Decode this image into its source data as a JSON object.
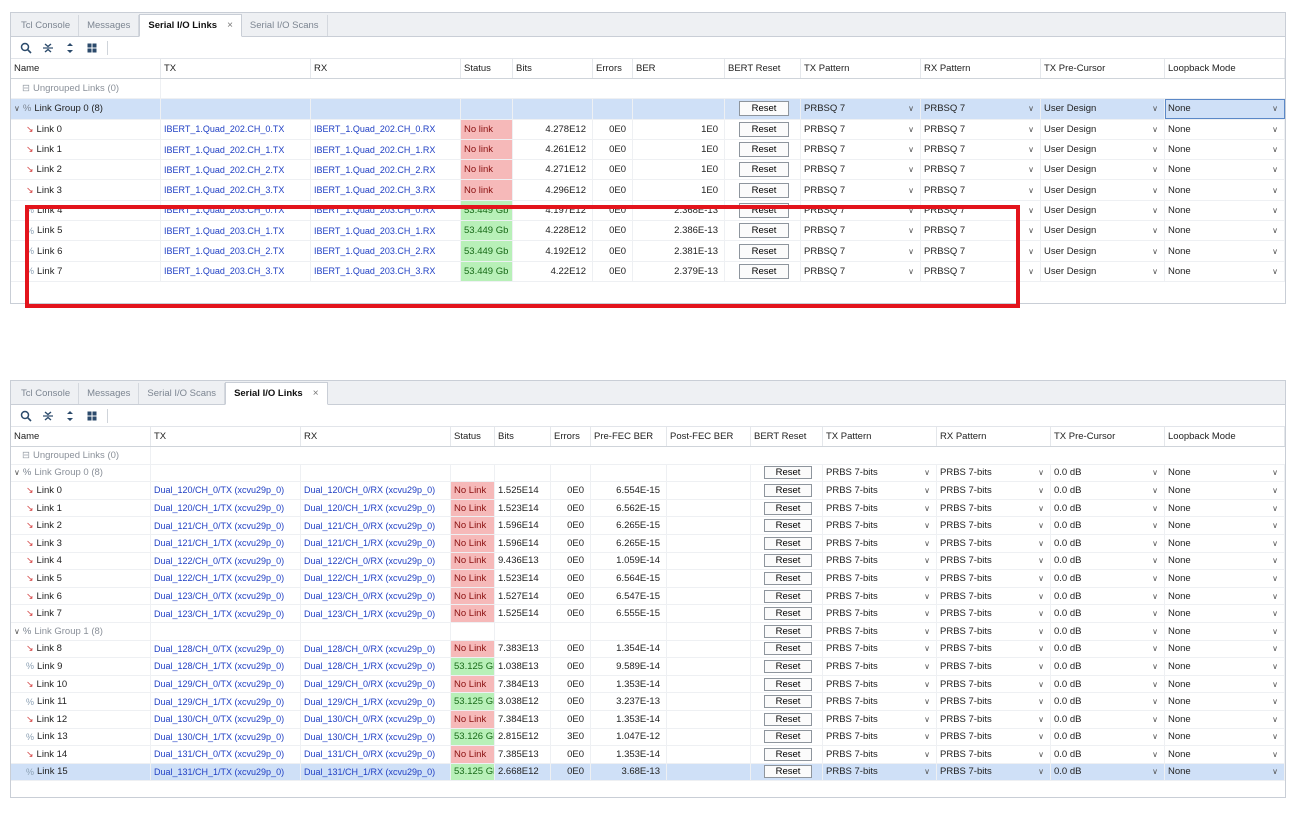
{
  "top": {
    "tabs": [
      {
        "label": "Tcl Console",
        "active": false
      },
      {
        "label": "Messages",
        "active": false
      },
      {
        "label": "Serial I/O Links",
        "active": true,
        "closable": true
      },
      {
        "label": "Serial I/O Scans",
        "active": false
      }
    ],
    "columns": [
      "Name",
      "TX",
      "RX",
      "Status",
      "Bits",
      "Errors",
      "BER",
      "BERT Reset",
      "TX Pattern",
      "RX Pattern",
      "TX Pre-Cursor",
      "Loopback Mode"
    ],
    "ungrouped": {
      "name": "Ungrouped Links",
      "count": "(0)"
    },
    "group": {
      "name": "Link Group 0",
      "count": "(8)",
      "reset": "Reset",
      "tx_pattern": "PRBSQ 7",
      "rx_pattern": "PRBSQ 7",
      "precursor": "User Design",
      "loopback": "None"
    },
    "rows": [
      {
        "name": "Link 0",
        "tx": "IBERT_1.Quad_202.CH_0.TX",
        "rx": "IBERT_1.Quad_202.CH_0.RX",
        "status": "No link",
        "ok": false,
        "bits": "4.278E12",
        "errors": "0E0",
        "ber": "1E0",
        "reset": "Reset",
        "tx_pattern": "PRBSQ 7",
        "rx_pattern": "PRBSQ 7",
        "precursor": "User Design",
        "loopback": "None"
      },
      {
        "name": "Link 1",
        "tx": "IBERT_1.Quad_202.CH_1.TX",
        "rx": "IBERT_1.Quad_202.CH_1.RX",
        "status": "No link",
        "ok": false,
        "bits": "4.261E12",
        "errors": "0E0",
        "ber": "1E0",
        "reset": "Reset",
        "tx_pattern": "PRBSQ 7",
        "rx_pattern": "PRBSQ 7",
        "precursor": "User Design",
        "loopback": "None"
      },
      {
        "name": "Link 2",
        "tx": "IBERT_1.Quad_202.CH_2.TX",
        "rx": "IBERT_1.Quad_202.CH_2.RX",
        "status": "No link",
        "ok": false,
        "bits": "4.271E12",
        "errors": "0E0",
        "ber": "1E0",
        "reset": "Reset",
        "tx_pattern": "PRBSQ 7",
        "rx_pattern": "PRBSQ 7",
        "precursor": "User Design",
        "loopback": "None"
      },
      {
        "name": "Link 3",
        "tx": "IBERT_1.Quad_202.CH_3.TX",
        "rx": "IBERT_1.Quad_202.CH_3.RX",
        "status": "No link",
        "ok": false,
        "bits": "4.296E12",
        "errors": "0E0",
        "ber": "1E0",
        "reset": "Reset",
        "tx_pattern": "PRBSQ 7",
        "rx_pattern": "PRBSQ 7",
        "precursor": "User Design",
        "loopback": "None"
      },
      {
        "name": "Link 4",
        "tx": "IBERT_1.Quad_203.CH_0.TX",
        "rx": "IBERT_1.Quad_203.CH_0.RX",
        "status": "53.449 Gb",
        "ok": true,
        "bits": "4.197E12",
        "errors": "0E0",
        "ber": "2.368E-13",
        "reset": "Reset",
        "tx_pattern": "PRBSQ 7",
        "rx_pattern": "PRBSQ 7",
        "precursor": "User Design",
        "loopback": "None"
      },
      {
        "name": "Link 5",
        "tx": "IBERT_1.Quad_203.CH_1.TX",
        "rx": "IBERT_1.Quad_203.CH_1.RX",
        "status": "53.449 Gb",
        "ok": true,
        "bits": "4.228E12",
        "errors": "0E0",
        "ber": "2.386E-13",
        "reset": "Reset",
        "tx_pattern": "PRBSQ 7",
        "rx_pattern": "PRBSQ 7",
        "precursor": "User Design",
        "loopback": "None"
      },
      {
        "name": "Link 6",
        "tx": "IBERT_1.Quad_203.CH_2.TX",
        "rx": "IBERT_1.Quad_203.CH_2.RX",
        "status": "53.449 Gb",
        "ok": true,
        "bits": "4.192E12",
        "errors": "0E0",
        "ber": "2.381E-13",
        "reset": "Reset",
        "tx_pattern": "PRBSQ 7",
        "rx_pattern": "PRBSQ 7",
        "precursor": "User Design",
        "loopback": "None"
      },
      {
        "name": "Link 7",
        "tx": "IBERT_1.Quad_203.CH_3.TX",
        "rx": "IBERT_1.Quad_203.CH_3.RX",
        "status": "53.449 Gb",
        "ok": true,
        "bits": "4.22E12",
        "errors": "0E0",
        "ber": "2.379E-13",
        "reset": "Reset",
        "tx_pattern": "PRBSQ 7",
        "rx_pattern": "PRBSQ 7",
        "precursor": "User Design",
        "loopback": "None"
      }
    ]
  },
  "bottom": {
    "tabs": [
      {
        "label": "Tcl Console",
        "active": false
      },
      {
        "label": "Messages",
        "active": false
      },
      {
        "label": "Serial I/O Scans",
        "active": false
      },
      {
        "label": "Serial I/O Links",
        "active": true,
        "closable": true
      }
    ],
    "columns": [
      "Name",
      "TX",
      "RX",
      "Status",
      "Bits",
      "Errors",
      "Pre-FEC BER",
      "Post-FEC BER",
      "BERT Reset",
      "TX Pattern",
      "RX Pattern",
      "TX Pre-Cursor",
      "Loopback Mode"
    ],
    "ungrouped": {
      "name": "Ungrouped Links",
      "count": "(0)"
    },
    "rows": [
      {
        "kind": "group",
        "name": "Link Group 0",
        "count": "(8)",
        "reset": "Reset",
        "tx_pattern": "PRBS 7-bits",
        "rx_pattern": "PRBS 7-bits",
        "precursor": "0.0 dB",
        "loopback": "None"
      },
      {
        "kind": "link",
        "name": "Link 0",
        "tx": "Dual_120/CH_0/TX (xcvu29p_0)",
        "rx": "Dual_120/CH_0/RX (xcvu29p_0)",
        "status": "No Link",
        "ok": false,
        "bits": "1.525E14",
        "errors": "0E0",
        "pre": "6.554E-15",
        "post": "",
        "reset": "Reset",
        "tx_pattern": "PRBS 7-bits",
        "rx_pattern": "PRBS 7-bits",
        "precursor": "0.0 dB",
        "loopback": "None"
      },
      {
        "kind": "link",
        "name": "Link 1",
        "tx": "Dual_120/CH_1/TX (xcvu29p_0)",
        "rx": "Dual_120/CH_1/RX (xcvu29p_0)",
        "status": "No Link",
        "ok": false,
        "bits": "1.523E14",
        "errors": "0E0",
        "pre": "6.562E-15",
        "post": "",
        "reset": "Reset",
        "tx_pattern": "PRBS 7-bits",
        "rx_pattern": "PRBS 7-bits",
        "precursor": "0.0 dB",
        "loopback": "None"
      },
      {
        "kind": "link",
        "name": "Link 2",
        "tx": "Dual_121/CH_0/TX (xcvu29p_0)",
        "rx": "Dual_121/CH_0/RX (xcvu29p_0)",
        "status": "No Link",
        "ok": false,
        "bits": "1.596E14",
        "errors": "0E0",
        "pre": "6.265E-15",
        "post": "",
        "reset": "Reset",
        "tx_pattern": "PRBS 7-bits",
        "rx_pattern": "PRBS 7-bits",
        "precursor": "0.0 dB",
        "loopback": "None"
      },
      {
        "kind": "link",
        "name": "Link 3",
        "tx": "Dual_121/CH_1/TX (xcvu29p_0)",
        "rx": "Dual_121/CH_1/RX (xcvu29p_0)",
        "status": "No Link",
        "ok": false,
        "bits": "1.596E14",
        "errors": "0E0",
        "pre": "6.265E-15",
        "post": "",
        "reset": "Reset",
        "tx_pattern": "PRBS 7-bits",
        "rx_pattern": "PRBS 7-bits",
        "precursor": "0.0 dB",
        "loopback": "None"
      },
      {
        "kind": "link",
        "name": "Link 4",
        "tx": "Dual_122/CH_0/TX (xcvu29p_0)",
        "rx": "Dual_122/CH_0/RX (xcvu29p_0)",
        "status": "No Link",
        "ok": false,
        "bits": "9.436E13",
        "errors": "0E0",
        "pre": "1.059E-14",
        "post": "",
        "reset": "Reset",
        "tx_pattern": "PRBS 7-bits",
        "rx_pattern": "PRBS 7-bits",
        "precursor": "0.0 dB",
        "loopback": "None"
      },
      {
        "kind": "link",
        "name": "Link 5",
        "tx": "Dual_122/CH_1/TX (xcvu29p_0)",
        "rx": "Dual_122/CH_1/RX (xcvu29p_0)",
        "status": "No Link",
        "ok": false,
        "bits": "1.523E14",
        "errors": "0E0",
        "pre": "6.564E-15",
        "post": "",
        "reset": "Reset",
        "tx_pattern": "PRBS 7-bits",
        "rx_pattern": "PRBS 7-bits",
        "precursor": "0.0 dB",
        "loopback": "None"
      },
      {
        "kind": "link",
        "name": "Link 6",
        "tx": "Dual_123/CH_0/TX (xcvu29p_0)",
        "rx": "Dual_123/CH_0/RX (xcvu29p_0)",
        "status": "No Link",
        "ok": false,
        "bits": "1.527E14",
        "errors": "0E0",
        "pre": "6.547E-15",
        "post": "",
        "reset": "Reset",
        "tx_pattern": "PRBS 7-bits",
        "rx_pattern": "PRBS 7-bits",
        "precursor": "0.0 dB",
        "loopback": "None"
      },
      {
        "kind": "link",
        "name": "Link 7",
        "tx": "Dual_123/CH_1/TX (xcvu29p_0)",
        "rx": "Dual_123/CH_1/RX (xcvu29p_0)",
        "status": "No Link",
        "ok": false,
        "bits": "1.525E14",
        "errors": "0E0",
        "pre": "6.555E-15",
        "post": "",
        "reset": "Reset",
        "tx_pattern": "PRBS 7-bits",
        "rx_pattern": "PRBS 7-bits",
        "precursor": "0.0 dB",
        "loopback": "None"
      },
      {
        "kind": "group",
        "name": "Link Group 1",
        "count": "(8)",
        "reset": "Reset",
        "tx_pattern": "PRBS 7-bits",
        "rx_pattern": "PRBS 7-bits",
        "precursor": "0.0 dB",
        "loopback": "None"
      },
      {
        "kind": "link",
        "name": "Link 8",
        "tx": "Dual_128/CH_0/TX (xcvu29p_0)",
        "rx": "Dual_128/CH_0/RX (xcvu29p_0)",
        "status": "No Link",
        "ok": false,
        "bits": "7.383E13",
        "errors": "0E0",
        "pre": "1.354E-14",
        "post": "",
        "reset": "Reset",
        "tx_pattern": "PRBS 7-bits",
        "rx_pattern": "PRBS 7-bits",
        "precursor": "0.0 dB",
        "loopback": "None"
      },
      {
        "kind": "link",
        "name": "Link 9",
        "tx": "Dual_128/CH_1/TX (xcvu29p_0)",
        "rx": "Dual_128/CH_1/RX (xcvu29p_0)",
        "status": "53.125 Gb",
        "ok": true,
        "bits": "1.038E13",
        "errors": "0E0",
        "pre": "9.589E-14",
        "post": "",
        "reset": "Reset",
        "tx_pattern": "PRBS 7-bits",
        "rx_pattern": "PRBS 7-bits",
        "precursor": "0.0 dB",
        "loopback": "None"
      },
      {
        "kind": "link",
        "name": "Link 10",
        "tx": "Dual_129/CH_0/TX (xcvu29p_0)",
        "rx": "Dual_129/CH_0/RX (xcvu29p_0)",
        "status": "No Link",
        "ok": false,
        "bits": "7.384E13",
        "errors": "0E0",
        "pre": "1.353E-14",
        "post": "",
        "reset": "Reset",
        "tx_pattern": "PRBS 7-bits",
        "rx_pattern": "PRBS 7-bits",
        "precursor": "0.0 dB",
        "loopback": "None"
      },
      {
        "kind": "link",
        "name": "Link 11",
        "tx": "Dual_129/CH_1/TX (xcvu29p_0)",
        "rx": "Dual_129/CH_1/RX (xcvu29p_0)",
        "status": "53.125 Gb",
        "ok": true,
        "bits": "3.038E12",
        "errors": "0E0",
        "pre": "3.237E-13",
        "post": "",
        "reset": "Reset",
        "tx_pattern": "PRBS 7-bits",
        "rx_pattern": "PRBS 7-bits",
        "precursor": "0.0 dB",
        "loopback": "None"
      },
      {
        "kind": "link",
        "name": "Link 12",
        "tx": "Dual_130/CH_0/TX (xcvu29p_0)",
        "rx": "Dual_130/CH_0/RX (xcvu29p_0)",
        "status": "No Link",
        "ok": false,
        "bits": "7.384E13",
        "errors": "0E0",
        "pre": "1.353E-14",
        "post": "",
        "reset": "Reset",
        "tx_pattern": "PRBS 7-bits",
        "rx_pattern": "PRBS 7-bits",
        "precursor": "0.0 dB",
        "loopback": "None"
      },
      {
        "kind": "link",
        "name": "Link 13",
        "tx": "Dual_130/CH_1/TX (xcvu29p_0)",
        "rx": "Dual_130/CH_1/RX (xcvu29p_0)",
        "status": "53.126 Gb",
        "ok": true,
        "bits": "2.815E12",
        "errors": "3E0",
        "pre": "1.047E-12",
        "post": "",
        "reset": "Reset",
        "tx_pattern": "PRBS 7-bits",
        "rx_pattern": "PRBS 7-bits",
        "precursor": "0.0 dB",
        "loopback": "None"
      },
      {
        "kind": "link",
        "name": "Link 14",
        "tx": "Dual_131/CH_0/TX (xcvu29p_0)",
        "rx": "Dual_131/CH_0/RX (xcvu29p_0)",
        "status": "No Link",
        "ok": false,
        "bits": "7.385E13",
        "errors": "0E0",
        "pre": "1.353E-14",
        "post": "",
        "reset": "Reset",
        "tx_pattern": "PRBS 7-bits",
        "rx_pattern": "PRBS 7-bits",
        "precursor": "0.0 dB",
        "loopback": "None"
      },
      {
        "kind": "link",
        "name": "Link 15",
        "tx": "Dual_131/CH_1/TX (xcvu29p_0)",
        "rx": "Dual_131/CH_1/RX (xcvu29p_0)",
        "status": "53.125 Gb",
        "ok": true,
        "bits": "2.668E12",
        "errors": "0E0",
        "pre": "3.68E-13",
        "post": "",
        "reset": "Reset",
        "tx_pattern": "PRBS 7-bits",
        "rx_pattern": "PRBS 7-bits",
        "precursor": "0.0 dB",
        "loopback": "None",
        "selected": true
      }
    ]
  },
  "toolbar_icons": [
    "search-icon",
    "collapse-all-icon",
    "expand-icon",
    "table-settings-icon"
  ],
  "colors": {
    "no_link": "#f6b9b9",
    "link_ok": "#b8f0b8",
    "highlight_box": "#e3141c",
    "selected_row": "#cfe0f7",
    "link_text": "#1f3fc4"
  }
}
